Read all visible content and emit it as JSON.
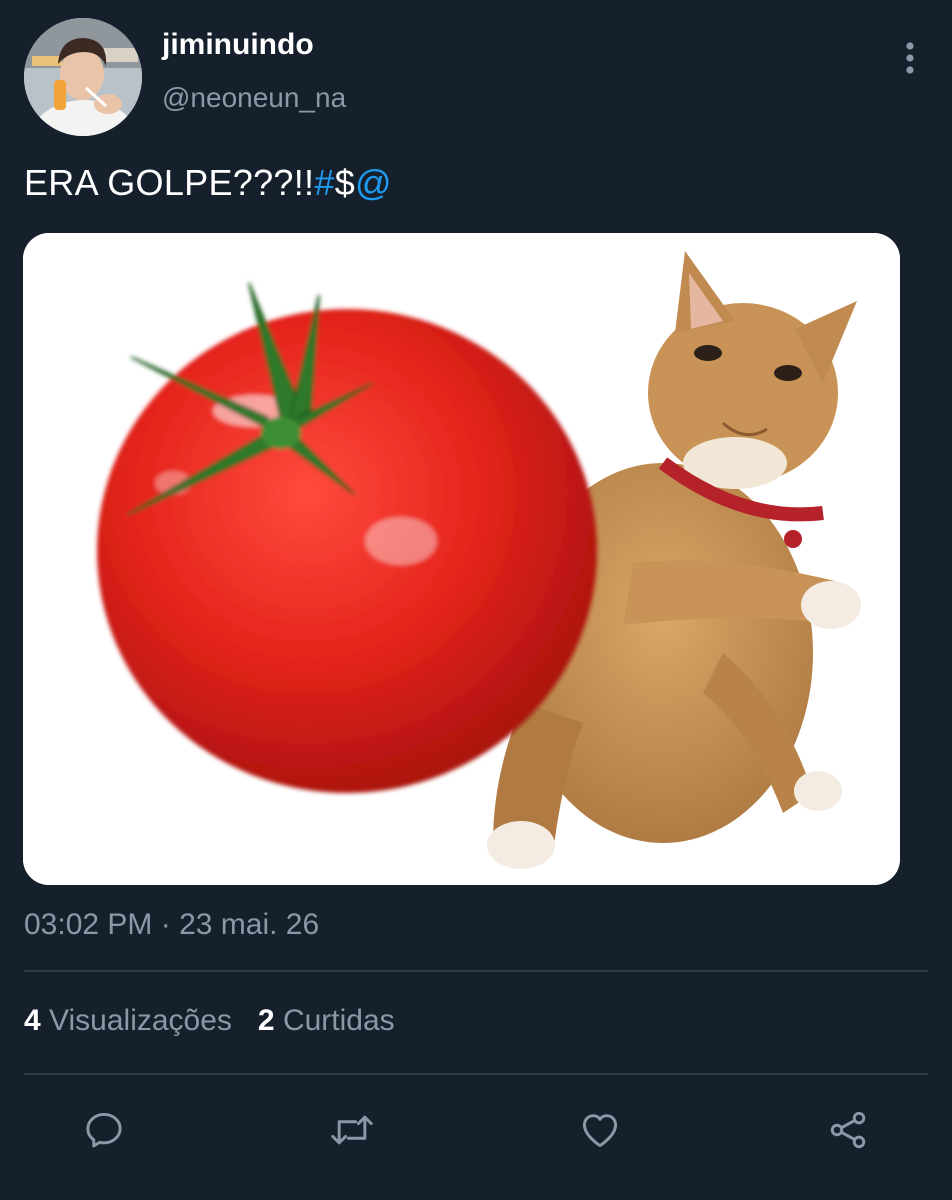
{
  "tweet": {
    "display_name": "jiminuindo",
    "handle": "@neoneun_na",
    "text_plain": "ERA GOLPE???!!",
    "text_hash": "#",
    "text_dollar": "$",
    "text_at": "@",
    "timestamp": "03:02 PM · 23 mai. 26"
  },
  "stats": {
    "views_count": "4",
    "views_label": "Visualizações",
    "likes_count": "2",
    "likes_label": "Curtidas"
  },
  "icons": {
    "more": "more-vertical-icon",
    "reply": "reply-icon",
    "retweet": "retweet-icon",
    "like": "heart-icon",
    "share": "share-icon"
  },
  "colors": {
    "background": "#16202c",
    "accent": "#1d9bf0",
    "secondary_text": "#8b98a5",
    "divider": "#2f3b48"
  }
}
